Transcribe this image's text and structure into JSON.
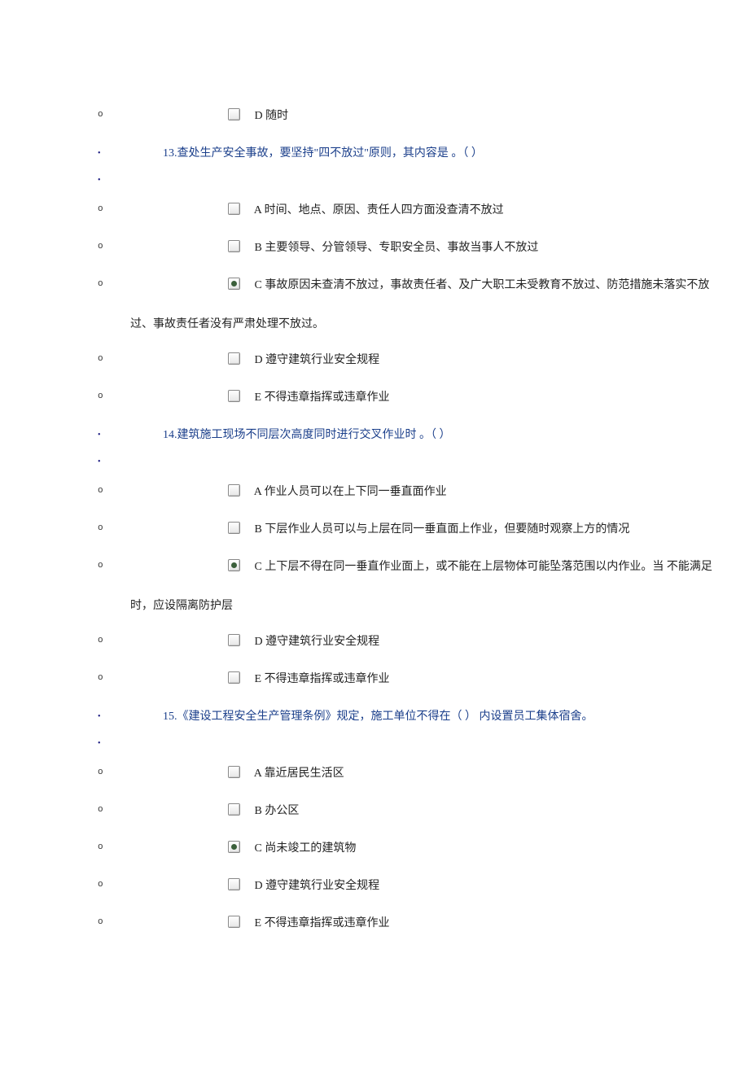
{
  "preamble_option": {
    "letter": "D ",
    "text": "随时"
  },
  "questions": [
    {
      "number": "13.",
      "stem": "查处生产安全事故，要坚持\"四不放过\"原则，其内容是 。（  ）",
      "options": [
        {
          "letter": "A ",
          "text": "时间、地点、原因、责任人四方面没查清不放过",
          "selected": false
        },
        {
          "letter": "B ",
          "text": "主要领导、分管领导、专职安全员、事故当事人不放过",
          "selected": false
        },
        {
          "letter": "C ",
          "text": "事故原因未查清不放过，事故责任者、及广大职工未受教育不放过、防范措施未落实不放过、事故责任者没有严肃处理不放过。",
          "selected": true,
          "wrap_tail": "过、事故责任者没有严肃处理不放过。",
          "wrap_head": "事故原因未查清不放过，事故责任者、及广大职工未受教育不放过、防范措施未落实不放"
        },
        {
          "letter": "D ",
          "text": "遵守建筑行业安全规程",
          "selected": false
        },
        {
          "letter": "E ",
          "text": "不得违章指挥或违章作业",
          "selected": false
        }
      ]
    },
    {
      "number": "14.",
      "stem": "建筑施工现场不同层次高度同时进行交叉作业时 。（  ）",
      "options": [
        {
          "letter": "A ",
          "text": "作业人员可以在上下同一垂直面作业",
          "selected": false
        },
        {
          "letter": "B ",
          "text": "下层作业人员可以与上层在同一垂直面上作业，但要随时观察上方的情况",
          "selected": false
        },
        {
          "letter": "C ",
          "text": "上下层不得在同一垂直作业面上，或不能在上层物体可能坠落范围以内作业。当 不能满足时，应设隔离防护层",
          "selected": true,
          "wrap_head": "上下层不得在同一垂直作业面上，或不能在上层物体可能坠落范围以内作业。当 不能满足",
          "wrap_tail": "时，应设隔离防护层"
        },
        {
          "letter": "D ",
          "text": "遵守建筑行业安全规程",
          "selected": false
        },
        {
          "letter": "E ",
          "text": "不得违章指挥或违章作业",
          "selected": false
        }
      ]
    },
    {
      "number": "15.",
      "stem": "《建设工程安全生产管理条例》规定，施工单位不得在（  ） 内设置员工集体宿舍。",
      "options": [
        {
          "letter": "A ",
          "text": "靠近居民生活区",
          "selected": false
        },
        {
          "letter": "B ",
          "text": "办公区",
          "selected": false
        },
        {
          "letter": "C ",
          "text": "尚未竣工的建筑物",
          "selected": true
        },
        {
          "letter": "D ",
          "text": "遵守建筑行业安全规程",
          "selected": false
        },
        {
          "letter": "E ",
          "text": "不得违章指挥或违章作业",
          "selected": false
        }
      ]
    }
  ]
}
